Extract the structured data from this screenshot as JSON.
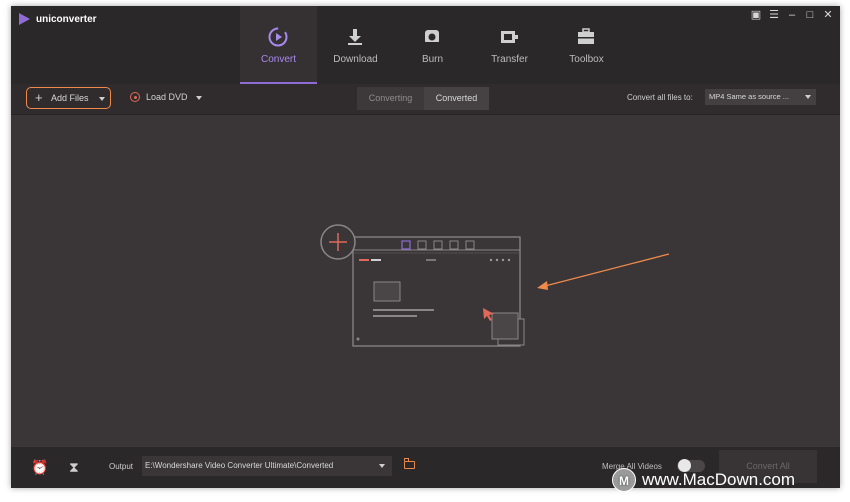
{
  "app": {
    "title": "uniconverter"
  },
  "window_controls": {
    "feedback": "▣",
    "menu": "☰",
    "minimize": "–",
    "maximize": "□",
    "close": "✕"
  },
  "nav": {
    "tabs": [
      {
        "label": "Convert",
        "icon": "convert-icon",
        "active": true
      },
      {
        "label": "Download",
        "icon": "download-icon",
        "active": false
      },
      {
        "label": "Burn",
        "icon": "burn-icon",
        "active": false
      },
      {
        "label": "Transfer",
        "icon": "transfer-icon",
        "active": false
      },
      {
        "label": "Toolbox",
        "icon": "toolbox-icon",
        "active": false
      }
    ]
  },
  "toolbar": {
    "add_files": "Add Files",
    "add_plus": "+",
    "load_dvd": "Load DVD",
    "segments": {
      "converting": "Converting",
      "converted": "Converted"
    },
    "convert_all_label": "Convert all files to:",
    "format_value": "MP4 Same as source ..."
  },
  "footer": {
    "output_label": "Output",
    "output_path": "E:\\Wondershare Video Converter Ultimate\\Converted",
    "merge_label": "Merge All Videos",
    "merge_enabled": false,
    "convert_all_button": "Convert All"
  },
  "watermark": {
    "text": "www.MacDown.com",
    "logo": "M"
  },
  "colors": {
    "accent": "#8f6bd6",
    "highlight": "#f08a4b",
    "bg": "#3a3637",
    "titlebar": "#2b2829"
  }
}
